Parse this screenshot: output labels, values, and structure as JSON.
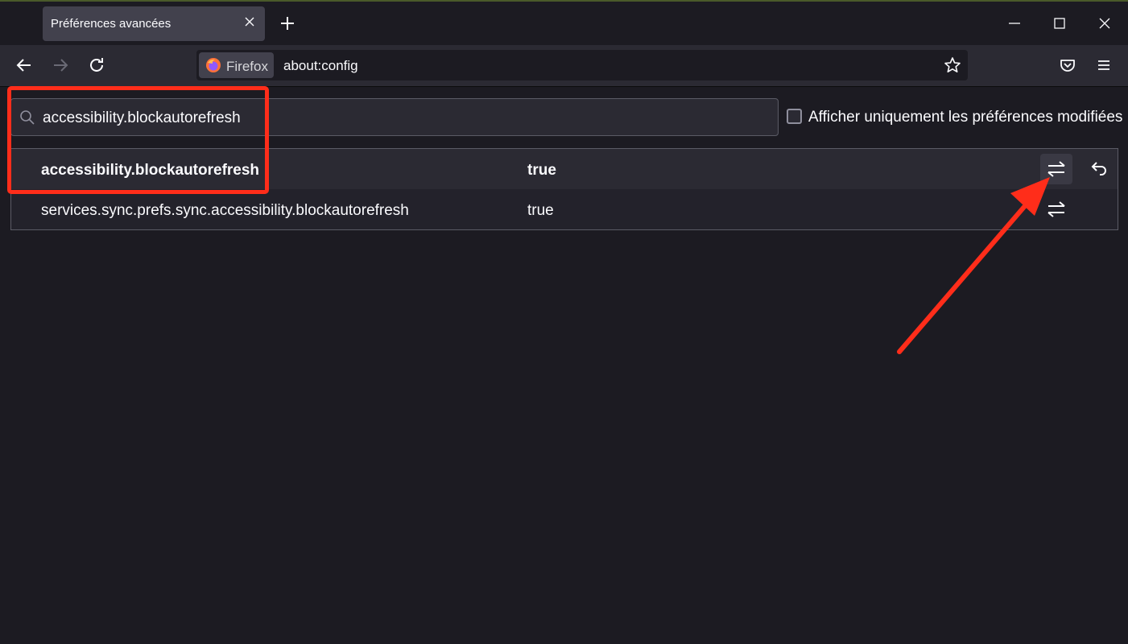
{
  "browser": {
    "tab": {
      "title": "Préférences avancées"
    },
    "urlbar": {
      "identity_label": "Firefox",
      "url": "about:config"
    }
  },
  "config": {
    "search": {
      "value": "accessibility.blockautorefresh"
    },
    "modified_only": {
      "label": "Afficher uniquement les préférences modifiées",
      "checked": false
    },
    "rows": [
      {
        "name": "accessibility.blockautorefresh",
        "value": "true",
        "modified": true
      },
      {
        "name": "services.sync.prefs.sync.accessibility.blockautorefresh",
        "value": "true",
        "modified": false
      }
    ]
  },
  "colors": {
    "annotation": "#ff2d1a",
    "background": "#1c1b22"
  }
}
